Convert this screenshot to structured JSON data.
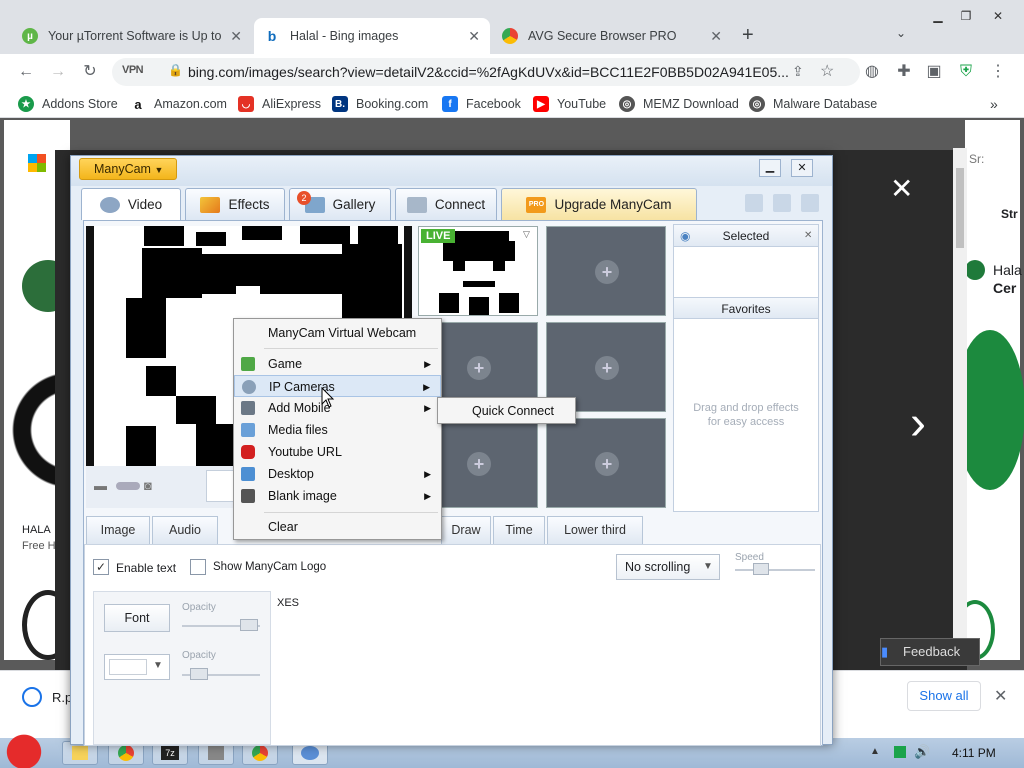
{
  "browser": {
    "tabs": [
      {
        "title": "Your µTorrent Software is Up to Date"
      },
      {
        "title": "Halal - Bing images"
      },
      {
        "title": "AVG Secure Browser PRO"
      }
    ],
    "url": "bing.com/images/search?view=detailV2&ccid=%2fAgKdUVx&id=BCC11E2F0BB5D02A941E05...",
    "vpn_label": "VPN",
    "bookmarks": [
      "Addons Store",
      "Amazon.com",
      "AliExpress",
      "Booking.com",
      "Facebook",
      "YouTube",
      "MEMZ Download",
      "Malware Database"
    ],
    "more_bookmarks": "»"
  },
  "bing": {
    "right_text_1": "Hala",
    "right_text_2": "Cer",
    "search_label": "Sr:",
    "search_value": "Str",
    "left_caption_1": "HALA",
    "left_caption_2": "Free H",
    "feedback": "Feedback",
    "close": "✕",
    "next": "›"
  },
  "manycam": {
    "brand": "ManyCam",
    "tabs": [
      "Video",
      "Effects",
      "Gallery",
      "Connect",
      "Upgrade ManyCam"
    ],
    "gallery_badge": "2",
    "pro_badge": "PRO",
    "live_badge": "LIVE",
    "selected_label": "Selected",
    "favorites_label": "Favorites",
    "drag_hint": "Drag and drop effects for easy access",
    "subtabs": [
      "Image",
      "Audio",
      "Draw",
      "Time",
      "Lower third"
    ],
    "enable_text": "Enable text",
    "show_logo": "Show ManyCam Logo",
    "scroll_option": "No scrolling",
    "speed_label": "Speed",
    "font_button": "Font",
    "opacity_label": "Opacity",
    "text_content": "XES"
  },
  "context_menu": {
    "items": [
      {
        "label": "ManyCam Virtual Webcam",
        "arrow": false
      },
      {
        "label": "Game",
        "arrow": true
      },
      {
        "label": "IP Cameras",
        "arrow": true
      },
      {
        "label": "Add Mobile",
        "arrow": true
      },
      {
        "label": "Media files",
        "arrow": false
      },
      {
        "label": "Youtube URL",
        "arrow": false
      },
      {
        "label": "Desktop",
        "arrow": true
      },
      {
        "label": "Blank image",
        "arrow": true
      },
      {
        "label": "Clear",
        "arrow": false
      }
    ],
    "submenu": [
      "Quick Connect"
    ]
  },
  "download_bar": {
    "file": "R.p",
    "show_all": "Show all"
  },
  "taskbar": {
    "clock": "4:11 PM"
  }
}
